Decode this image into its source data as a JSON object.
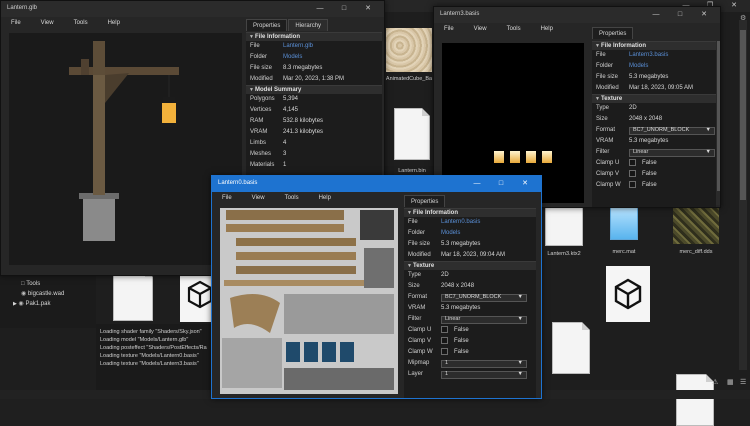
{
  "main_window": {
    "title": "Lantern.glb",
    "menu": [
      "File",
      "View",
      "Tools",
      "Help"
    ],
    "tabs": [
      "Properties",
      "Hierarchy"
    ],
    "file_info": {
      "header": "File Information",
      "rows": [
        {
          "k": "File",
          "v": "Lantern.glb",
          "link": true
        },
        {
          "k": "Folder",
          "v": "Models",
          "link": true
        },
        {
          "k": "File size",
          "v": "8.3 megabytes",
          "link": false
        },
        {
          "k": "Modified",
          "v": "Mar 20, 2023, 1:38 PM",
          "link": false
        }
      ]
    },
    "model_summary": {
      "header": "Model Summary",
      "rows": [
        {
          "k": "Polygons",
          "v": "5,394"
        },
        {
          "k": "Vertices",
          "v": "4,145"
        },
        {
          "k": "RAM",
          "v": "532.8 kilobytes"
        },
        {
          "k": "VRAM",
          "v": "241.3 kilobytes"
        },
        {
          "k": "Limbs",
          "v": "4"
        },
        {
          "k": "Meshes",
          "v": "3"
        },
        {
          "k": "Materials",
          "v": "1"
        }
      ]
    }
  },
  "browser": {
    "tree": [
      {
        "icon": "file-icon",
        "label": "Tools"
      },
      {
        "icon": "archive-icon",
        "label": "bigcastle.wad"
      },
      {
        "icon": "archive-icon",
        "label": "Pak1.pak"
      }
    ],
    "files": [
      {
        "name": "AnimatedCube_Ba",
        "kind": "sand-texture"
      },
      {
        "name": "Lantern.bin",
        "kind": "doc"
      },
      {
        "name": "Lantern3.ktx2",
        "kind": "doc"
      },
      {
        "name": "merc.mat",
        "kind": "notepad"
      },
      {
        "name": "merc_diff.dds",
        "kind": "armor-texture"
      }
    ],
    "log": [
      "Loading shader family \"Shaders/Sky.json\"",
      "Loading model \"Models/Lantern.glb\"",
      "Loading posteffect \"Shaders/PostEffects/Ra",
      "Loading texture \"Models/Lantern0.basis\"",
      "Loading texture \"Models/Lantern3.basis\""
    ]
  },
  "window3": {
    "title": "Lantern3.basis",
    "menu": [
      "File",
      "View",
      "Tools",
      "Help"
    ],
    "tab": "Properties",
    "file_info": {
      "header": "File Information",
      "rows": [
        {
          "k": "File",
          "v": "Lantern3.basis",
          "link": true
        },
        {
          "k": "Folder",
          "v": "Models",
          "link": true
        },
        {
          "k": "File size",
          "v": "5.3 megabytes",
          "link": false
        },
        {
          "k": "Modified",
          "v": "Mar 18, 2023, 09:05 AM",
          "link": false
        }
      ]
    },
    "texture": {
      "header": "Texture",
      "type": "2D",
      "size": "2048 x 2048",
      "format": "BC7_UNORM_BLOCK",
      "vram": "5.3 megabytes",
      "filter": "Linear",
      "clamp_u": "False",
      "clamp_v": "False",
      "clamp_w": "False"
    },
    "labels": {
      "type": "Type",
      "size": "Size",
      "format": "Format",
      "vram": "VRAM",
      "filter": "Filter",
      "clamp_u": "Clamp U",
      "clamp_v": "Clamp V",
      "clamp_w": "Clamp W"
    }
  },
  "window2": {
    "title": "Lantern0.basis",
    "menu": [
      "File",
      "View",
      "Tools",
      "Help"
    ],
    "tab": "Properties",
    "file_info": {
      "header": "File Information",
      "rows": [
        {
          "k": "File",
          "v": "Lantern0.basis",
          "link": true
        },
        {
          "k": "Folder",
          "v": "Models",
          "link": true
        },
        {
          "k": "File size",
          "v": "5.3 megabytes",
          "link": false
        },
        {
          "k": "Modified",
          "v": "Mar 18, 2023, 09:04 AM",
          "link": false
        }
      ]
    },
    "texture": {
      "header": "Texture",
      "type": "2D",
      "size": "2048 x 2048",
      "format": "BC7_UNORM_BLOCK",
      "vram": "5.3 megabytes",
      "filter": "Linear",
      "clamp_u": "False",
      "clamp_v": "False",
      "clamp_w": "False",
      "mipmap": "1",
      "layer": "1"
    },
    "labels": {
      "type": "Type",
      "size": "Size",
      "format": "Format",
      "vram": "VRAM",
      "filter": "Filter",
      "clamp_u": "Clamp U",
      "clamp_v": "Clamp V",
      "clamp_w": "Clamp W",
      "mipmap": "Mipmap",
      "layer": "Layer"
    }
  },
  "colors": {
    "accent": "#1e73d0",
    "link": "#5a8fd6",
    "bg": "#1f1f1f"
  }
}
